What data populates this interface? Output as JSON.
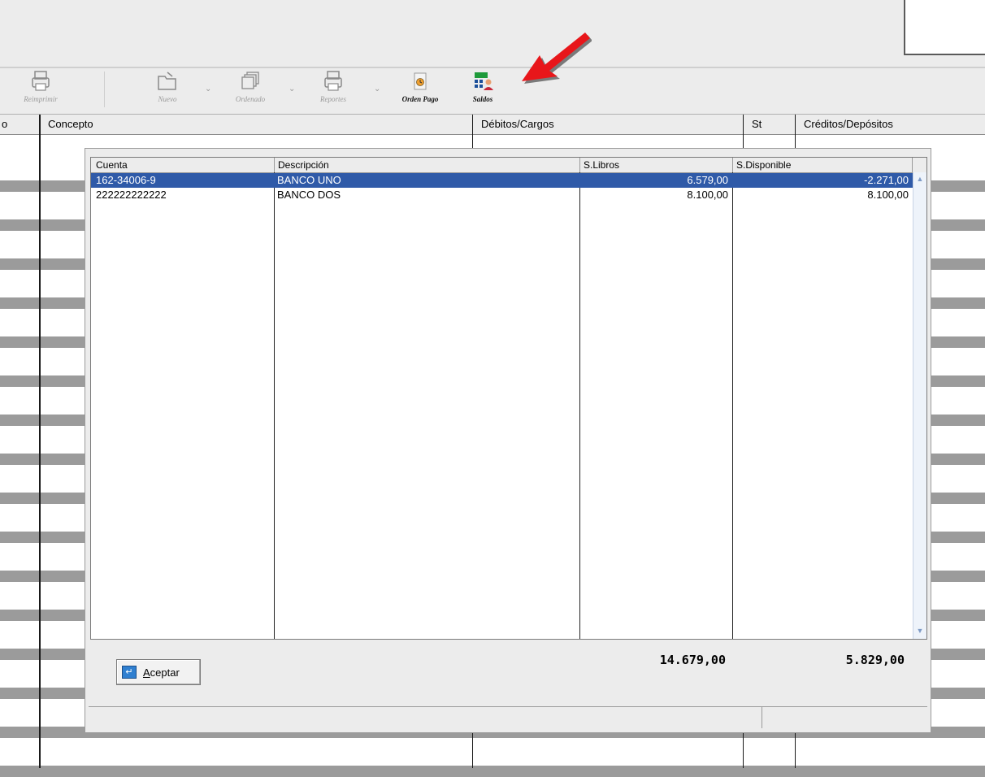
{
  "toolbar": {
    "buttons": [
      {
        "label": "Reimprimir",
        "icon": "printer-icon",
        "active": false
      },
      {
        "label": "Nuevo",
        "icon": "open-folder-icon",
        "active": false
      },
      {
        "label": "Ordenado",
        "icon": "stack-icon",
        "active": false
      },
      {
        "label": "Reportes",
        "icon": "printer-icon",
        "active": false
      },
      {
        "label": "Orden Pago",
        "icon": "clock-document-icon",
        "active": true
      },
      {
        "label": "Saldos",
        "icon": "balance-users-icon",
        "active": true
      }
    ]
  },
  "grid": {
    "columns": [
      "o",
      "Concepto",
      "Débitos/Cargos",
      "St",
      "Créditos/Depósitos"
    ]
  },
  "dialog": {
    "columns": [
      "Cuenta",
      "Descripción",
      "S.Libros",
      "S.Disponible"
    ],
    "rows": [
      {
        "cuenta": "162-34006-9",
        "descripcion": "BANCO UNO",
        "libros": "6.579,00",
        "disponible": "-2.271,00",
        "selected": true
      },
      {
        "cuenta": "222222222222",
        "descripcion": "BANCO DOS",
        "libros": "8.100,00",
        "disponible": "8.100,00",
        "selected": false
      }
    ],
    "totals": {
      "libros": "14.679,00",
      "disponible": "5.829,00"
    },
    "ok_button": {
      "accesskey": "A",
      "rest": "ceptar"
    }
  },
  "colors": {
    "selection": "#2f5aa8",
    "red_arrow": "#e8161a",
    "orange_arrow": "#f5a01a"
  }
}
